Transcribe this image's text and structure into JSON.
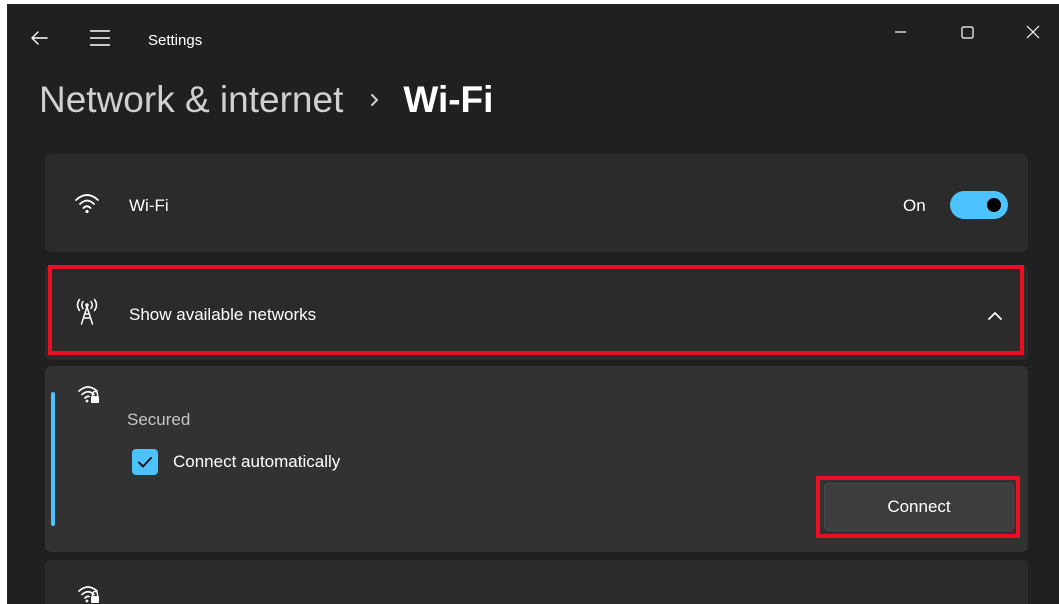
{
  "window": {
    "title": "Settings"
  },
  "breadcrumb": {
    "parent": "Network & internet",
    "current": "Wi-Fi"
  },
  "wifi_row": {
    "label": "Wi-Fi",
    "icon": "wifi-icon",
    "toggle_state": "On",
    "toggle_on": true
  },
  "show_networks_row": {
    "label": "Show available networks",
    "icon": "antenna-icon",
    "expanded": true
  },
  "network_item": {
    "icon": "wifi-secured-icon",
    "security": "Secured",
    "connect_automatically": {
      "label": "Connect automatically",
      "checked": true
    },
    "connect_button": "Connect"
  },
  "network_item_2": {
    "icon": "wifi-secured-icon"
  },
  "colors": {
    "background": "#202020",
    "card": "#2b2b2b",
    "accent": "#4cc2ff",
    "highlight": "#e81123"
  }
}
